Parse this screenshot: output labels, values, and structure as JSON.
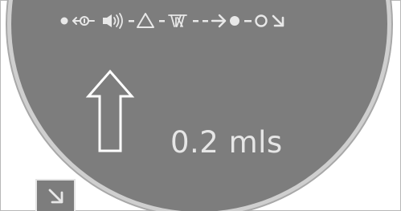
{
  "display": {
    "speed_text": "0.2 mls",
    "dial_color": "#7d7d7d",
    "foreground_color": "#e6e6e6"
  },
  "status_icons": [
    "dot-icon",
    "remote-transmitter-icon",
    "speaker-icon",
    "warning-triangle-icon",
    "lamp-icon",
    "arrow-right-icon",
    "dot-icon",
    "ring-icon",
    "arrow-down-right-icon"
  ],
  "main_indicator": {
    "icon": "arrow-up-icon"
  },
  "corner_button": {
    "icon": "arrow-down-right-icon"
  }
}
